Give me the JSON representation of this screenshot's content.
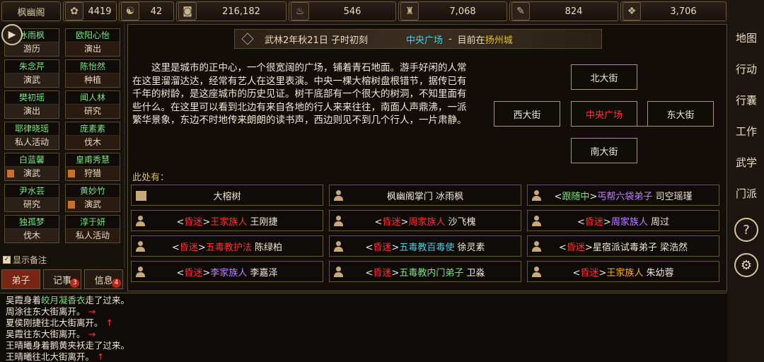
{
  "topbar": {
    "sect_name": "枫幽阁",
    "resources": [
      {
        "icon": "fame-icon",
        "value": "4419"
      },
      {
        "icon": "yinyang-icon",
        "value": "42"
      },
      {
        "icon": "coin-icon",
        "value": "216,182"
      },
      {
        "icon": "food-icon",
        "value": "546"
      },
      {
        "icon": "herb-icon",
        "value": "7,068"
      },
      {
        "icon": "scroll-icon",
        "value": "824"
      },
      {
        "icon": "ore-icon",
        "value": "3,706"
      }
    ]
  },
  "right_menu": [
    "地图",
    "行动",
    "行囊",
    "工作",
    "武学",
    "门派",
    "?",
    "⚙"
  ],
  "disciples": [
    {
      "name": "冰雨枫",
      "activity": "游历",
      "mark": false
    },
    {
      "name": "欧阳心怡",
      "activity": "演出",
      "mark": false
    },
    {
      "name": "朱念芹",
      "activity": "演武",
      "mark": false
    },
    {
      "name": "陈怡然",
      "activity": "种植",
      "mark": false
    },
    {
      "name": "樊初瑶",
      "activity": "演出",
      "mark": false
    },
    {
      "name": "闻人林",
      "activity": "研究",
      "mark": false
    },
    {
      "name": "耶律晓瑶",
      "activity": "私人活动",
      "mark": false
    },
    {
      "name": "庞素素",
      "activity": "伐木",
      "mark": false
    },
    {
      "name": "白蓝馨",
      "activity": "演武",
      "mark": true
    },
    {
      "name": "皇甫秀慧",
      "activity": "狩猎",
      "mark": true
    },
    {
      "name": "尹水芸",
      "activity": "研究",
      "mark": false
    },
    {
      "name": "黄妙竹",
      "activity": "演武",
      "mark": true
    },
    {
      "name": "独孤梦",
      "activity": "伐木",
      "mark": false
    },
    {
      "name": "淳于妍",
      "activity": "私人活动",
      "mark": false
    }
  ],
  "show_note_label": "显示备注",
  "left_tabs": [
    {
      "label": "弟子",
      "badge": ""
    },
    {
      "label": "记事",
      "badge": "3"
    },
    {
      "label": "信息",
      "badge": "4"
    }
  ],
  "scene": {
    "date": "武林2年秋21日 子时初刻",
    "location": "中央广场",
    "sep": "-",
    "current_prefix": "目前在",
    "city": "扬州城",
    "description": "这里是城市的正中心，一个很宽阔的广场，铺着青石地面。游手好闲的人常在这里溜溜达达，经常有艺人在这里表演。中央一棵大榕树盘根错节，据传已有千年的树龄，是这座城市的历史见证。树干底部有一个很大的树洞，不知里面有些什么。在这里可以看到北边有来自各地的行人来来往往，南面人声鼎沸，一派繁华景象，东边不时地传来朗朗的读书声，西边则见不到几个行人，一片肃静。"
  },
  "map": {
    "north": "北大街",
    "west": "西大街",
    "center": "中央广场",
    "east": "东大街",
    "south": "南大街",
    "center_color": "#ff3030"
  },
  "here_label": "此处有：",
  "npcs": [
    {
      "type": "object",
      "tag": "",
      "group": "",
      "group_color": "#f0e8d8",
      "name": "大榕树"
    },
    {
      "type": "person",
      "tag": "",
      "group": "枫幽阁掌门",
      "group_color": "#f0e8d8",
      "name": "冰雨枫"
    },
    {
      "type": "person",
      "tag": "跟随中",
      "tag_color": "#7ee07e",
      "group": "丐帮六袋弟子",
      "group_color": "#c080ff",
      "name": "司空瑶瑾"
    },
    {
      "type": "person",
      "tag": "昏迷",
      "tag_color": "#ff3030",
      "group": "王家族人",
      "group_color": "#ff3030",
      "name": "王刚捷"
    },
    {
      "type": "person",
      "tag": "昏迷",
      "tag_color": "#ff3030",
      "group": "周家族人",
      "group_color": "#ff3030",
      "name": "沙飞槐"
    },
    {
      "type": "person",
      "tag": "昏迷",
      "tag_color": "#ff3030",
      "group": "周家族人",
      "group_color": "#c080ff",
      "name": "周过"
    },
    {
      "type": "person",
      "tag": "昏迷",
      "tag_color": "#ff3030",
      "group": "五毒教护法",
      "group_color": "#ff3030",
      "name": "陈绿柏"
    },
    {
      "type": "person",
      "tag": "昏迷",
      "tag_color": "#ff3030",
      "group": "五毒教百毒使",
      "group_color": "#4ec8e0",
      "name": "徐灵素"
    },
    {
      "type": "person",
      "tag": "昏迷",
      "tag_color": "#ff3030",
      "group": "星宿派试毒弟子",
      "group_color": "#f0e8d8",
      "name": "梁浩然"
    },
    {
      "type": "person",
      "tag": "昏迷",
      "tag_color": "#ff3030",
      "group": "李家族人",
      "group_color": "#c080ff",
      "name": "李嘉泽"
    },
    {
      "type": "person",
      "tag": "昏迷",
      "tag_color": "#ff3030",
      "group": "五毒教内门弟子",
      "group_color": "#7ee07e",
      "name": "卫淼"
    },
    {
      "type": "person",
      "tag": "昏迷",
      "tag_color": "#ff3030",
      "group": "王家族人",
      "group_color": "#ffb000",
      "name": "朱幼蓉"
    }
  ],
  "log": [
    {
      "pre": "吴霞身着",
      "hl": "皎月凝香衣",
      "post": "走了过来。",
      "arrow": ""
    },
    {
      "pre": "周涂往东大街离开。",
      "hl": "",
      "post": "",
      "arrow": "→"
    },
    {
      "pre": "夏侯刚捷往北大街离开。",
      "hl": "",
      "post": "",
      "arrow": "↑"
    },
    {
      "pre": "吴霞往东大街离开。",
      "hl": "",
      "post": "",
      "arrow": "→"
    },
    {
      "pre": "王晴曦身着鹅黄夹袄走了过来。",
      "hl": "",
      "post": "",
      "arrow": ""
    },
    {
      "pre": "王晴曦往北大街离开。",
      "hl": "",
      "post": "",
      "arrow": "↑"
    }
  ]
}
